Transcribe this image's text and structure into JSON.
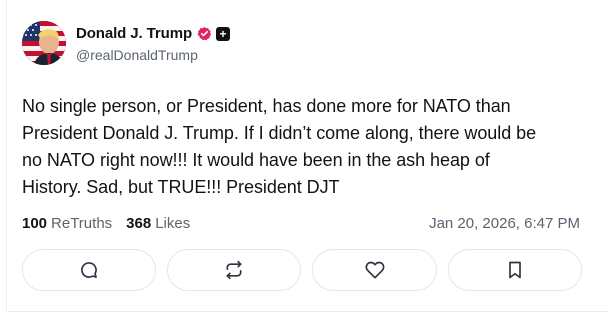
{
  "post": {
    "author": {
      "display_name": "Donald J. Trump",
      "handle": "@realDonaldTrump",
      "verified_color": "#e0245e",
      "plus_badge": "+"
    },
    "text": "No single person, or President, has done more for NATO than\nPresident Donald J. Trump. If I didn’t come along, there would be\nno NATO right now!!! It would have been in the ash heap of\nHistory. Sad, but TRUE!!! President DJT",
    "stats": {
      "retruths_count": "100",
      "retruths_label": "ReTruths",
      "likes_count": "368",
      "likes_label": "Likes"
    },
    "timestamp": "Jan 20, 2026, 6:47 PM"
  },
  "actions": [
    {
      "icon": "reply-icon"
    },
    {
      "icon": "retruth-icon"
    },
    {
      "icon": "like-icon"
    },
    {
      "icon": "bookmark-icon"
    }
  ],
  "colors": {
    "text_primary": "#0f1419",
    "text_secondary": "#5b6470",
    "border": "#e3e6ea"
  }
}
